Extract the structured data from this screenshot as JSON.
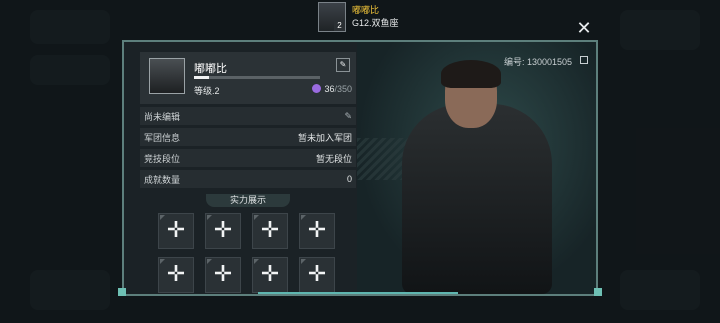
{
  "top_player": {
    "name": "嘟嘟比",
    "subtitle": "G12.双鱼座",
    "level": "2"
  },
  "close_icon": "close-icon",
  "profile": {
    "name": "嘟嘟比",
    "level_label": "等级.2",
    "xp_progress": 0.12,
    "energy_current": "36",
    "energy_max": "/350",
    "id_label": "编号: 130001505"
  },
  "info_rows": [
    {
      "label": "尚未编辑",
      "value": ""
    },
    {
      "label": "军团信息",
      "value": "暂未加入军团"
    },
    {
      "label": "竞技段位",
      "value": "暂无段位"
    },
    {
      "label": "成就数量",
      "value": "0"
    }
  ],
  "showcase": {
    "title": "实力展示",
    "slot_icon": "plus-icon",
    "slot_glyph": "✛",
    "slot_count": 8
  },
  "colors": {
    "accent": "#5fb6b0",
    "name_yellow": "#f3c63a",
    "energy": "#9a6be0"
  }
}
